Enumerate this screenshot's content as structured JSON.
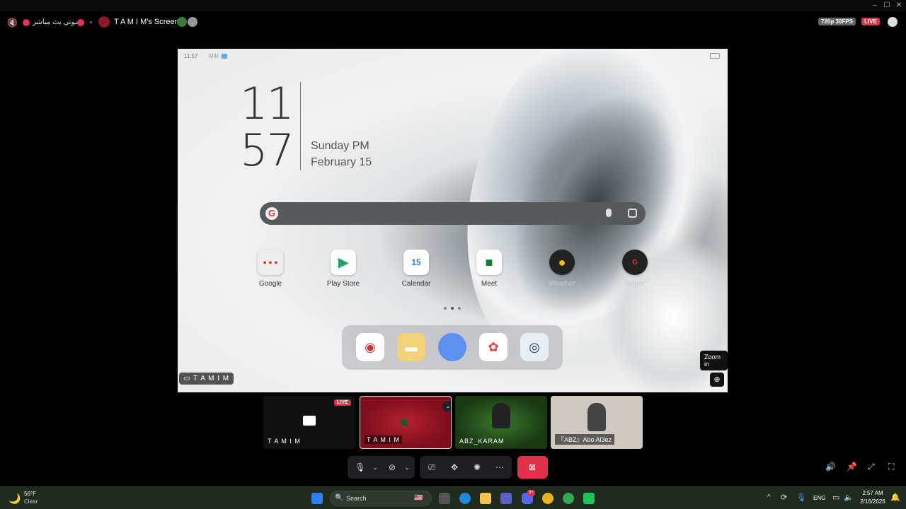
{
  "window": {
    "minimize_icon": "minimize-icon",
    "maximize_icon": "maximize-icon",
    "close_icon": "close-icon"
  },
  "topbar": {
    "channel_name": "صوتي بث مباشر",
    "screen_title": "T A M I M's Screen",
    "quality": "720p 30FPS",
    "live": "LIVE"
  },
  "phone": {
    "status_time": "11:57",
    "status_extra": "M4ℓ",
    "clock_hour": "11",
    "clock_minute": "57",
    "day": "Sunday PM",
    "date": "February 15",
    "apps": [
      {
        "label": "Google"
      },
      {
        "label": "Play Store"
      },
      {
        "label": "Calendar",
        "badge": "15"
      },
      {
        "label": "Meet"
      },
      {
        "label": "Weather"
      },
      {
        "label": "Goper"
      }
    ],
    "page_dots": 3
  },
  "stream_label": "T A M I M",
  "zoom_tooltip": "Zoom in",
  "participants": [
    {
      "name": "T A M I M",
      "live": "LIVE"
    },
    {
      "name": "T A M I M"
    },
    {
      "name": "ABZ_KARAM"
    },
    {
      "name": "『ABZ』Abo Al3ez"
    }
  ],
  "taskbar": {
    "weather_temp": "56°F",
    "weather_desc": "Clear",
    "search_placeholder": "Search",
    "lang": "ENG",
    "time": "2:57 AM",
    "date": "2/16/2026",
    "discord_badge": "9+"
  },
  "colors": {
    "live": "#e0334a",
    "end_call": "#e0334a",
    "accent": "#2d7ff9"
  }
}
